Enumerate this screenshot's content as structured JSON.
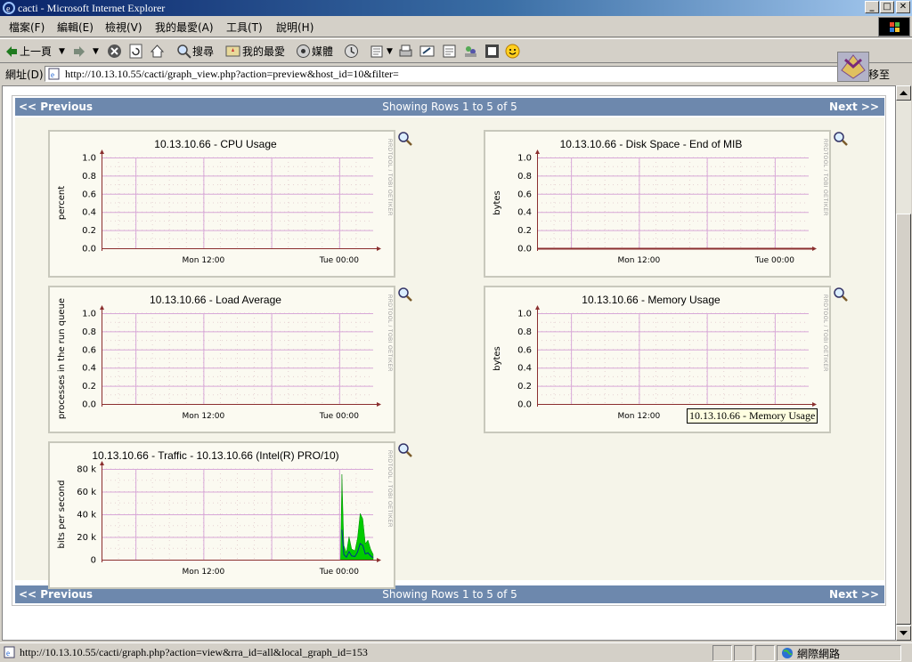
{
  "window": {
    "title": "cacti - Microsoft Internet Explorer",
    "controls": {
      "minimize": "_",
      "maximize": "□",
      "close": "✕"
    }
  },
  "menu": [
    "檔案(F)",
    "編輯(E)",
    "檢視(V)",
    "我的最愛(A)",
    "工具(T)",
    "說明(H)"
  ],
  "toolbar": {
    "back": "上一頁",
    "search": "搜尋",
    "favorites": "我的最愛",
    "media": "媒體"
  },
  "address": {
    "label": "網址(D)",
    "url": "http://10.13.10.55/cacti/graph_view.php?action=preview&host_id=10&filter=",
    "go": "移至"
  },
  "page": {
    "nav_top": {
      "prev": "<< Previous",
      "rows": "Showing Rows 1 to 5 of 5",
      "next": "Next >>"
    },
    "nav_bottom": {
      "prev": "<< Previous",
      "rows": "Showing Rows 1 to 5 of 5",
      "next": "Next >>"
    },
    "rrd_watermark": "RRDTOOL / TOBI OETIKER"
  },
  "graphs": [
    {
      "title": "10.13.10.66 - CPU Usage",
      "ylabel": "percent",
      "yticks": [
        "1.0",
        "0.8",
        "0.6",
        "0.4",
        "0.2",
        "0.0"
      ],
      "xticks": [
        "Mon 12:00",
        "Tue 00:00"
      ]
    },
    {
      "title": "10.13.10.66 - Disk Space - End of MIB",
      "ylabel": "bytes",
      "yticks": [
        "1.0",
        "0.8",
        "0.6",
        "0.4",
        "0.2",
        "0.0"
      ],
      "xticks": [
        "Mon 12:00",
        "Tue 00:00"
      ]
    },
    {
      "title": "10.13.10.66 - Load Average",
      "ylabel": "processes in the run queue",
      "yticks": [
        "1.0",
        "0.8",
        "0.6",
        "0.4",
        "0.2",
        "0.0"
      ],
      "xticks": [
        "Mon 12:00",
        "Tue 00:00"
      ]
    },
    {
      "title": "10.13.10.66 - Memory Usage",
      "ylabel": "bytes",
      "yticks": [
        "1.0",
        "0.8",
        "0.6",
        "0.4",
        "0.2",
        "0.0"
      ],
      "xticks": [
        "Mon 12:00",
        "Tue 00:00"
      ]
    },
    {
      "title": "10.13.10.66 - Traffic - 10.13.10.66 (Intel(R) PRO/10)",
      "ylabel": "bits per second",
      "yticks": [
        "80 k",
        "60 k",
        "40 k",
        "20 k",
        "0"
      ],
      "xticks": [
        "Mon 12:00",
        "Tue 00:00"
      ]
    }
  ],
  "tooltip": "10.13.10.66 - Memory Usage",
  "status": {
    "text": "http://10.13.10.55/cacti/graph.php?action=view&rra_id=all&local_graph_id=153",
    "zone": "網際網路"
  },
  "colors": {
    "nav": "#6d88ad",
    "grid_major": "#d8a8d8",
    "axis": "#8b2f2f",
    "traffic_fill": "#00cc00"
  }
}
